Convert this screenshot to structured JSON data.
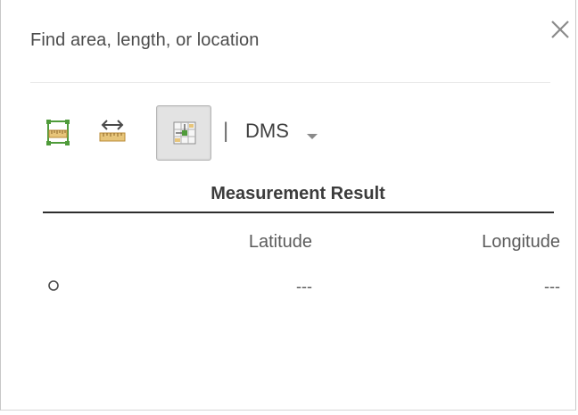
{
  "panel": {
    "title": "Find area, length, or location",
    "close_icon": "close-icon"
  },
  "toolbar": {
    "tools": [
      {
        "name": "area",
        "icon": "area-measure-icon",
        "active": false
      },
      {
        "name": "distance",
        "icon": "distance-measure-icon",
        "active": false
      },
      {
        "name": "location",
        "icon": "location-measure-icon",
        "active": true
      }
    ],
    "separator": "|",
    "unit_selected": "DMS",
    "unit_caret_icon": "caret-down-icon"
  },
  "results": {
    "title": "Measurement Result",
    "columns": [
      "Latitude",
      "Longitude"
    ],
    "rows": [
      {
        "icon": "point-marker-icon",
        "latitude": "---",
        "longitude": "---"
      }
    ]
  },
  "colors": {
    "text": "#4c4c4c",
    "tool_green": "#4f9b3a",
    "tool_tan": "#c29a4a",
    "active_tool_bg": "#e3e3e3"
  }
}
